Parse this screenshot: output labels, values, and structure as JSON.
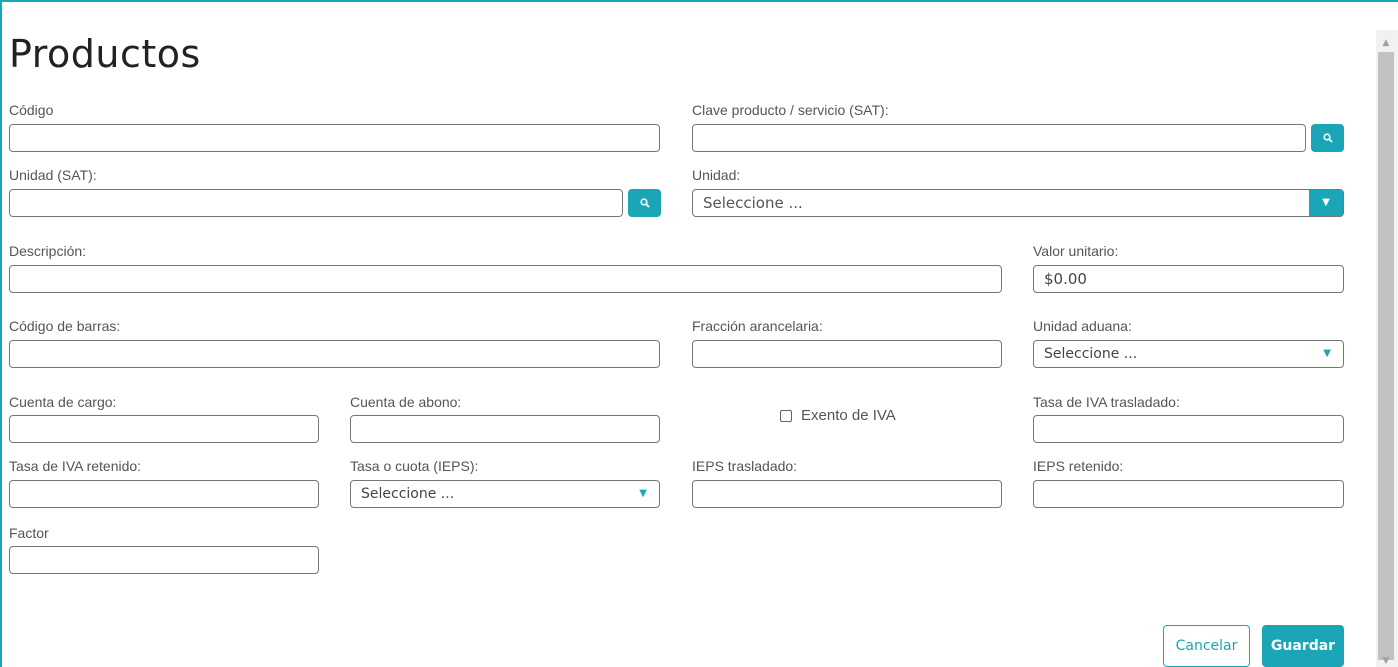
{
  "title": "Productos",
  "colors": {
    "accent": "#1aa6b7"
  },
  "fields": {
    "codigo": {
      "label": "Código",
      "value": ""
    },
    "clave_sat": {
      "label": "Clave producto / servicio (SAT):",
      "value": ""
    },
    "unidad_sat": {
      "label": "Unidad (SAT):",
      "value": ""
    },
    "unidad": {
      "label": "Unidad:",
      "value": "Seleccione ..."
    },
    "descripcion": {
      "label": "Descripción:",
      "value": ""
    },
    "valor_unitario": {
      "label": "Valor unitario:",
      "value": "$0.00"
    },
    "codigo_barras": {
      "label": "Código de barras:",
      "value": ""
    },
    "fraccion": {
      "label": "Fracción arancelaria:",
      "value": ""
    },
    "unidad_aduana": {
      "label": "Unidad aduana:",
      "value": "Seleccione ..."
    },
    "cuenta_cargo": {
      "label": "Cuenta de cargo:",
      "value": ""
    },
    "cuenta_abono": {
      "label": "Cuenta de abono:",
      "value": ""
    },
    "exento_iva": {
      "label": "Exento de IVA",
      "checked": false
    },
    "tasa_iva_tras": {
      "label": "Tasa de IVA trasladado:",
      "value": ""
    },
    "tasa_iva_ret": {
      "label": "Tasa de IVA retenido:",
      "value": ""
    },
    "tasa_ieps": {
      "label": "Tasa o cuota (IEPS):",
      "value": "Seleccione ..."
    },
    "ieps_tras": {
      "label": "IEPS trasladado:",
      "value": ""
    },
    "ieps_ret": {
      "label": "IEPS retenido:",
      "value": ""
    },
    "factor": {
      "label": "Factor",
      "value": ""
    }
  },
  "buttons": {
    "cancel": "Cancelar",
    "save": "Guardar"
  },
  "icons": {
    "search": "search-icon",
    "dropdown": "caret-down-icon"
  }
}
